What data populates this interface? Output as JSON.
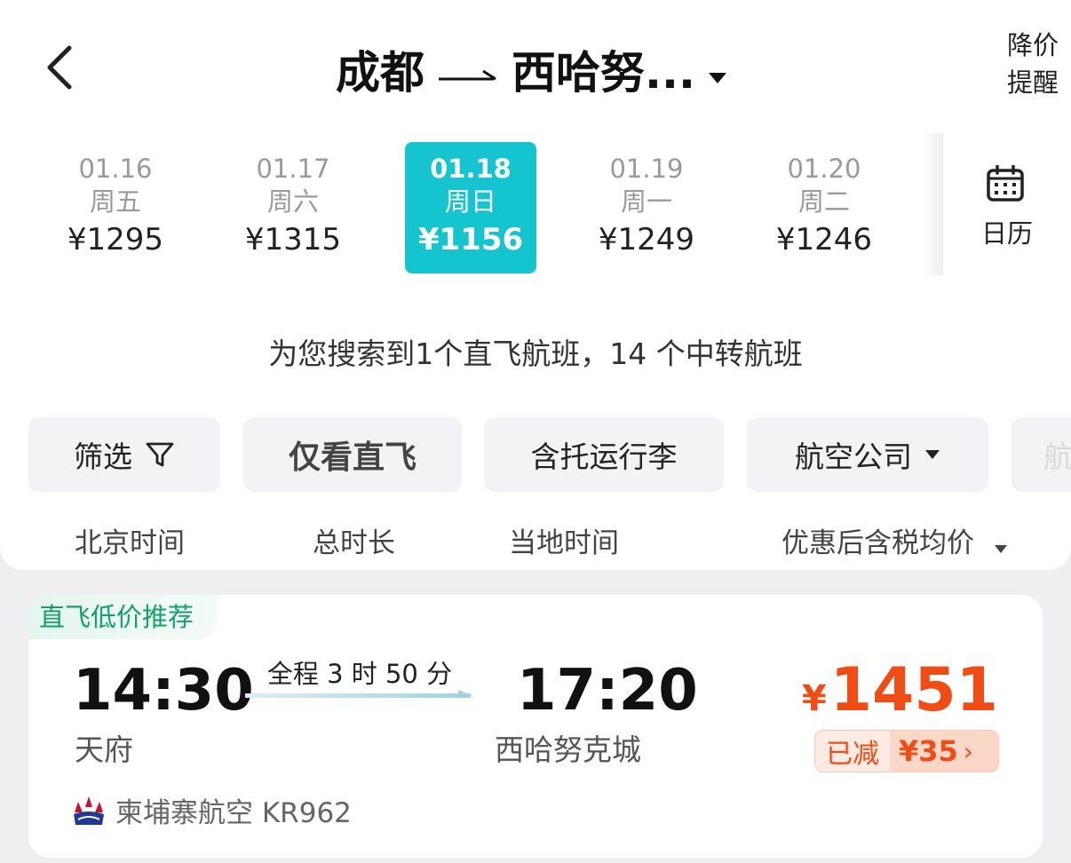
{
  "header": {
    "origin": "成都",
    "destination": "西哈努...",
    "price_alert_line1": "降价",
    "price_alert_line2": "提醒"
  },
  "dates": [
    {
      "date": "01.16",
      "weekday": "周五",
      "price": "¥1295",
      "active": false
    },
    {
      "date": "01.17",
      "weekday": "周六",
      "price": "¥1315",
      "active": false
    },
    {
      "date": "01.18",
      "weekday": "周日",
      "price": "¥1156",
      "active": true
    },
    {
      "date": "01.19",
      "weekday": "周一",
      "price": "¥1249",
      "active": false
    },
    {
      "date": "01.20",
      "weekday": "周二",
      "price": "¥1246",
      "active": false
    }
  ],
  "calendar": {
    "label": "日历",
    "icon": "calendar-icon"
  },
  "summary": "为您搜索到1个直飞航班，14 个中转航班",
  "filters": {
    "filter_label": "筛选",
    "direct_only": "仅看直飞",
    "carry_on": "含托运行李",
    "airline": "航空公司",
    "partial": "航"
  },
  "sort": {
    "beijing_time": "北京时间",
    "total_duration": "总时长",
    "local_time": "当地时间",
    "price_after_discount": "优惠后含税均价"
  },
  "flight": {
    "tag": "直飞低价推荐",
    "dep_time": "14:30",
    "dep_airport": "天府",
    "duration": "全程 3 时 50 分",
    "arr_time": "17:20",
    "arr_airport": "西哈努克城",
    "currency": "¥",
    "price": "1451",
    "discount_label": "已减",
    "discount_amount": "¥35",
    "airline": "柬埔寨航空 KR962"
  },
  "colors": {
    "accent": "#14c4cf",
    "price": "#f04c14",
    "tag_green": "#14a06a"
  }
}
